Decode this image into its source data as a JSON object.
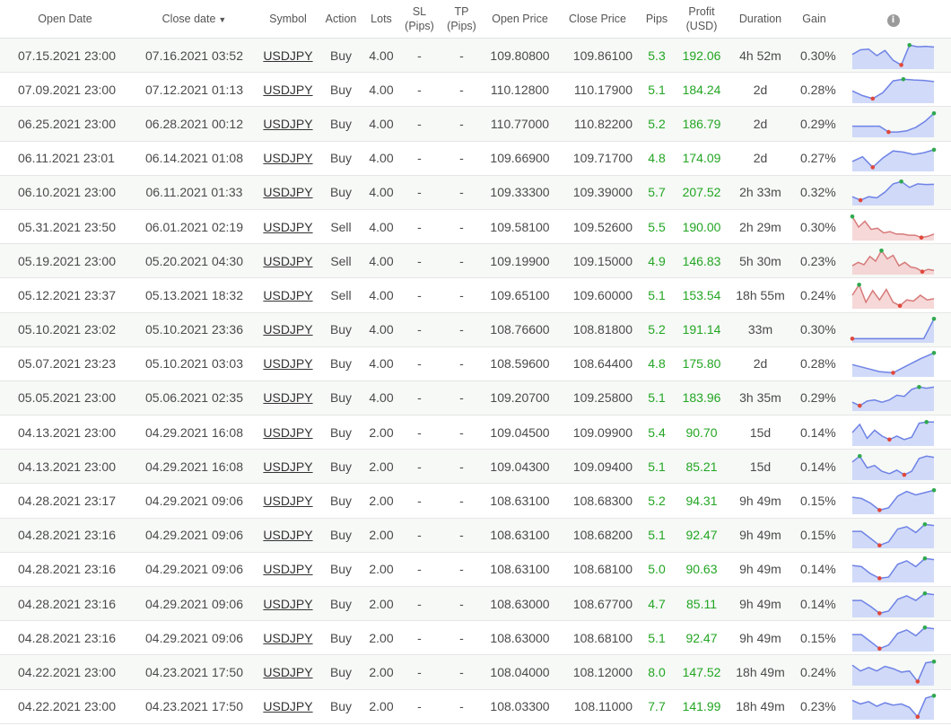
{
  "headers": {
    "open_date": "Open Date",
    "close_date": "Close date",
    "sort_arrow": "▼",
    "symbol": "Symbol",
    "action": "Action",
    "lots": "Lots",
    "sl": "SL",
    "sl_unit": "(Pips)",
    "tp": "TP",
    "tp_unit": "(Pips)",
    "open_price": "Open Price",
    "close_price": "Close Price",
    "pips": "Pips",
    "profit": "Profit",
    "profit_unit": "(USD)",
    "duration": "Duration",
    "gain": "Gain",
    "info_icon": "i"
  },
  "colors": {
    "profit": "#23a523",
    "buy_fill": "#c9d4f7",
    "buy_line": "#6f83e6",
    "sell_fill": "#f2c7c7",
    "sell_line": "#d77a7a",
    "max_dot": "#2fa84f",
    "min_dot": "#e0483b",
    "row_alt": "#f6f9f6"
  },
  "rows": [
    {
      "open_date": "07.15.2021 23:00",
      "close_date": "07.16.2021 03:52",
      "symbol": "USDJPY",
      "action": "Buy",
      "lots": "4.00",
      "sl": "-",
      "tp": "-",
      "open_price": "109.80800",
      "close_price": "109.86100",
      "pips": "5.3",
      "profit": "192.06",
      "duration": "4h 52m",
      "gain": "0.30%",
      "spark": [
        0.55,
        0.75,
        0.78,
        0.5,
        0.72,
        0.3,
        0.1,
        0.95,
        0.88,
        0.9,
        0.87
      ]
    },
    {
      "open_date": "07.09.2021 23:00",
      "close_date": "07.12.2021 01:13",
      "symbol": "USDJPY",
      "action": "Buy",
      "lots": "4.00",
      "sl": "-",
      "tp": "-",
      "open_price": "110.12800",
      "close_price": "110.17900",
      "pips": "5.1",
      "profit": "184.24",
      "duration": "2d",
      "gain": "0.28%",
      "spark": [
        0.45,
        0.25,
        0.12,
        0.38,
        0.88,
        0.95,
        0.92,
        0.9,
        0.85
      ]
    },
    {
      "open_date": "06.25.2021 23:00",
      "close_date": "06.28.2021 00:12",
      "symbol": "USDJPY",
      "action": "Buy",
      "lots": "4.00",
      "sl": "-",
      "tp": "-",
      "open_price": "110.77000",
      "close_price": "110.82200",
      "pips": "5.2",
      "profit": "186.79",
      "duration": "2d",
      "gain": "0.29%",
      "spark": [
        0.4,
        0.4,
        0.4,
        0.4,
        0.15,
        0.15,
        0.2,
        0.35,
        0.6,
        0.95
      ]
    },
    {
      "open_date": "06.11.2021 23:01",
      "close_date": "06.14.2021 01:08",
      "symbol": "USDJPY",
      "action": "Buy",
      "lots": "4.00",
      "sl": "-",
      "tp": "-",
      "open_price": "109.66900",
      "close_price": "109.71700",
      "pips": "4.8",
      "profit": "174.09",
      "duration": "2d",
      "gain": "0.27%",
      "spark": [
        0.35,
        0.55,
        0.1,
        0.5,
        0.8,
        0.75,
        0.65,
        0.72,
        0.85
      ]
    },
    {
      "open_date": "06.10.2021 23:00",
      "close_date": "06.11.2021 01:33",
      "symbol": "USDJPY",
      "action": "Buy",
      "lots": "4.00",
      "sl": "-",
      "tp": "-",
      "open_price": "109.33300",
      "close_price": "109.39000",
      "pips": "5.7",
      "profit": "207.52",
      "duration": "2h 33m",
      "gain": "0.32%",
      "spark": [
        0.3,
        0.15,
        0.3,
        0.25,
        0.5,
        0.85,
        0.95,
        0.7,
        0.85,
        0.82,
        0.83
      ]
    },
    {
      "open_date": "05.31.2021 23:50",
      "close_date": "06.01.2021 02:19",
      "symbol": "USDJPY",
      "action": "Sell",
      "lots": "4.00",
      "sl": "-",
      "tp": "-",
      "open_price": "109.58100",
      "close_price": "109.52600",
      "pips": "5.5",
      "profit": "190.00",
      "duration": "2h 29m",
      "gain": "0.30%",
      "spark": [
        0.95,
        0.5,
        0.75,
        0.4,
        0.45,
        0.25,
        0.3,
        0.2,
        0.2,
        0.15,
        0.15,
        0.05,
        0.1,
        0.2
      ]
    },
    {
      "open_date": "05.19.2021 23:00",
      "close_date": "05.20.2021 04:30",
      "symbol": "USDJPY",
      "action": "Sell",
      "lots": "4.00",
      "sl": "-",
      "tp": "-",
      "open_price": "109.19900",
      "close_price": "109.15000",
      "pips": "4.9",
      "profit": "146.83",
      "duration": "5h 30m",
      "gain": "0.23%",
      "spark": [
        0.3,
        0.45,
        0.35,
        0.7,
        0.5,
        0.95,
        0.6,
        0.75,
        0.3,
        0.45,
        0.25,
        0.2,
        0.05,
        0.15,
        0.1
      ]
    },
    {
      "open_date": "05.12.2021 23:37",
      "close_date": "05.13.2021 18:32",
      "symbol": "USDJPY",
      "action": "Sell",
      "lots": "4.00",
      "sl": "-",
      "tp": "-",
      "open_price": "109.65100",
      "close_price": "109.60000",
      "pips": "5.1",
      "profit": "153.54",
      "duration": "18h 55m",
      "gain": "0.24%",
      "spark": [
        0.5,
        0.95,
        0.2,
        0.7,
        0.3,
        0.75,
        0.2,
        0.05,
        0.3,
        0.25,
        0.5,
        0.3,
        0.35
      ]
    },
    {
      "open_date": "05.10.2021 23:02",
      "close_date": "05.10.2021 23:36",
      "symbol": "USDJPY",
      "action": "Buy",
      "lots": "4.00",
      "sl": "-",
      "tp": "-",
      "open_price": "108.76600",
      "close_price": "108.81800",
      "pips": "5.2",
      "profit": "191.14",
      "duration": "33m",
      "gain": "0.30%",
      "spark": [
        0.1,
        0.1,
        0.1,
        0.1,
        0.1,
        0.1,
        0.1,
        0.1,
        0.95
      ]
    },
    {
      "open_date": "05.07.2021 23:23",
      "close_date": "05.10.2021 03:03",
      "symbol": "USDJPY",
      "action": "Buy",
      "lots": "4.00",
      "sl": "-",
      "tp": "-",
      "open_price": "108.59600",
      "close_price": "108.64400",
      "pips": "4.8",
      "profit": "175.80",
      "duration": "2d",
      "gain": "0.28%",
      "spark": [
        0.45,
        0.3,
        0.15,
        0.1,
        0.4,
        0.7,
        0.95
      ]
    },
    {
      "open_date": "05.05.2021 23:00",
      "close_date": "05.06.2021 02:35",
      "symbol": "USDJPY",
      "action": "Buy",
      "lots": "4.00",
      "sl": "-",
      "tp": "-",
      "open_price": "109.20700",
      "close_price": "109.25800",
      "pips": "5.1",
      "profit": "183.96",
      "duration": "3h 35m",
      "gain": "0.29%",
      "spark": [
        0.3,
        0.15,
        0.35,
        0.4,
        0.3,
        0.4,
        0.6,
        0.55,
        0.85,
        0.95,
        0.9,
        0.95
      ]
    },
    {
      "open_date": "04.13.2021 23:00",
      "close_date": "04.29.2021 16:08",
      "symbol": "USDJPY",
      "action": "Buy",
      "lots": "2.00",
      "sl": "-",
      "tp": "-",
      "open_price": "109.04500",
      "close_price": "109.09900",
      "pips": "5.4",
      "profit": "90.70",
      "duration": "15d",
      "gain": "0.14%",
      "spark": [
        0.5,
        0.85,
        0.25,
        0.6,
        0.35,
        0.2,
        0.35,
        0.2,
        0.3,
        0.9,
        0.95,
        0.95
      ]
    },
    {
      "open_date": "04.13.2021 23:00",
      "close_date": "04.29.2021 16:08",
      "symbol": "USDJPY",
      "action": "Buy",
      "lots": "2.00",
      "sl": "-",
      "tp": "-",
      "open_price": "109.04300",
      "close_price": "109.09400",
      "pips": "5.1",
      "profit": "85.21",
      "duration": "15d",
      "gain": "0.14%",
      "spark": [
        0.7,
        0.95,
        0.45,
        0.55,
        0.3,
        0.2,
        0.35,
        0.15,
        0.3,
        0.85,
        0.95,
        0.9
      ]
    },
    {
      "open_date": "04.28.2021 23:17",
      "close_date": "04.29.2021 09:06",
      "symbol": "USDJPY",
      "action": "Buy",
      "lots": "2.00",
      "sl": "-",
      "tp": "-",
      "open_price": "108.63100",
      "close_price": "108.68300",
      "pips": "5.2",
      "profit": "94.31",
      "duration": "9h 49m",
      "gain": "0.15%",
      "spark": [
        0.65,
        0.6,
        0.4,
        0.1,
        0.2,
        0.7,
        0.9,
        0.75,
        0.85,
        0.95
      ]
    },
    {
      "open_date": "04.28.2021 23:16",
      "close_date": "04.29.2021 09:06",
      "symbol": "USDJPY",
      "action": "Buy",
      "lots": "2.00",
      "sl": "-",
      "tp": "-",
      "open_price": "108.63100",
      "close_price": "108.68200",
      "pips": "5.1",
      "profit": "92.47",
      "duration": "9h 49m",
      "gain": "0.15%",
      "spark": [
        0.65,
        0.65,
        0.35,
        0.05,
        0.2,
        0.75,
        0.85,
        0.6,
        0.95,
        0.9
      ]
    },
    {
      "open_date": "04.28.2021 23:16",
      "close_date": "04.29.2021 09:06",
      "symbol": "USDJPY",
      "action": "Buy",
      "lots": "2.00",
      "sl": "-",
      "tp": "-",
      "open_price": "108.63100",
      "close_price": "108.68100",
      "pips": "5.0",
      "profit": "90.63",
      "duration": "9h 49m",
      "gain": "0.14%",
      "spark": [
        0.65,
        0.6,
        0.3,
        0.1,
        0.15,
        0.7,
        0.85,
        0.6,
        0.95,
        0.9
      ]
    },
    {
      "open_date": "04.28.2021 23:16",
      "close_date": "04.29.2021 09:06",
      "symbol": "USDJPY",
      "action": "Buy",
      "lots": "2.00",
      "sl": "-",
      "tp": "-",
      "open_price": "108.63000",
      "close_price": "108.67700",
      "pips": "4.7",
      "profit": "85.11",
      "duration": "9h 49m",
      "gain": "0.14%",
      "spark": [
        0.65,
        0.65,
        0.4,
        0.1,
        0.2,
        0.7,
        0.85,
        0.65,
        0.95,
        0.9
      ]
    },
    {
      "open_date": "04.28.2021 23:16",
      "close_date": "04.29.2021 09:06",
      "symbol": "USDJPY",
      "action": "Buy",
      "lots": "2.00",
      "sl": "-",
      "tp": "-",
      "open_price": "108.63000",
      "close_price": "108.68100",
      "pips": "5.1",
      "profit": "92.47",
      "duration": "9h 49m",
      "gain": "0.15%",
      "spark": [
        0.65,
        0.65,
        0.35,
        0.05,
        0.2,
        0.7,
        0.85,
        0.6,
        0.95,
        0.9
      ]
    },
    {
      "open_date": "04.22.2021 23:00",
      "close_date": "04.23.2021 17:50",
      "symbol": "USDJPY",
      "action": "Buy",
      "lots": "2.00",
      "sl": "-",
      "tp": "-",
      "open_price": "108.04000",
      "close_price": "108.12000",
      "pips": "8.0",
      "profit": "147.52",
      "duration": "18h 49m",
      "gain": "0.24%",
      "spark": [
        0.8,
        0.55,
        0.7,
        0.55,
        0.75,
        0.65,
        0.5,
        0.55,
        0.1,
        0.9,
        0.95
      ]
    },
    {
      "open_date": "04.22.2021 23:00",
      "close_date": "04.23.2021 17:50",
      "symbol": "USDJPY",
      "action": "Buy",
      "lots": "2.00",
      "sl": "-",
      "tp": "-",
      "open_price": "108.03300",
      "close_price": "108.11000",
      "pips": "7.7",
      "profit": "141.99",
      "duration": "18h 49m",
      "gain": "0.23%",
      "spark": [
        0.75,
        0.6,
        0.7,
        0.5,
        0.65,
        0.55,
        0.6,
        0.45,
        0.05,
        0.85,
        0.95
      ]
    }
  ]
}
